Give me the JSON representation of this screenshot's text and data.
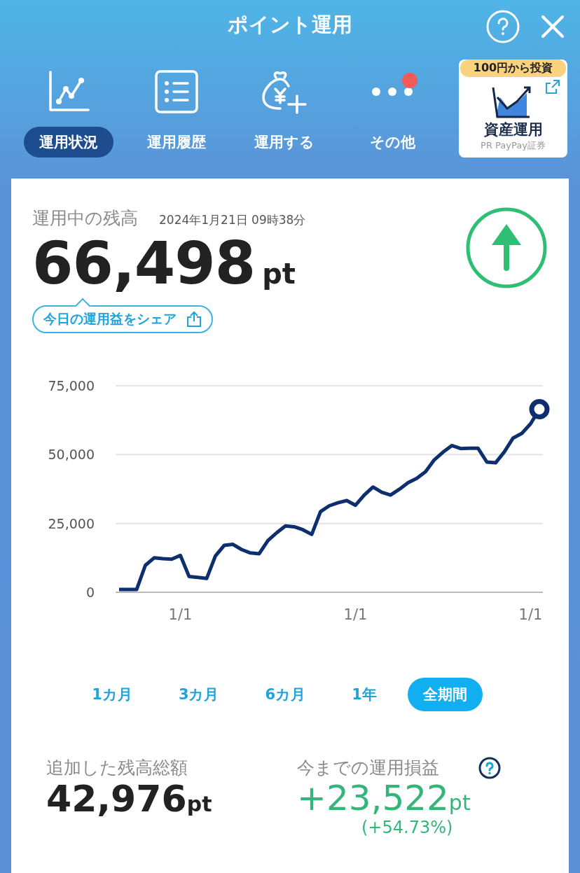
{
  "header": {
    "title": "ポイント運用"
  },
  "nav_tabs": [
    {
      "label": "運用状況",
      "selected": true,
      "kind": "chart",
      "dot": false
    },
    {
      "label": "運用履歴",
      "selected": false,
      "kind": "list",
      "dot": false
    },
    {
      "label": "運用する",
      "selected": false,
      "kind": "bag",
      "dot": false
    },
    {
      "label": "その他",
      "selected": false,
      "kind": "more",
      "dot": true
    }
  ],
  "promo": {
    "badge": "100円から投資",
    "title": "資産運用",
    "caption": "PR PayPay証券"
  },
  "balance": {
    "label": "運用中の残高",
    "timestamp": "2024年1月21日 09時38分",
    "amount": "66,498",
    "unit": "pt",
    "rising": true,
    "share_label": "今日の運用益をシェア"
  },
  "chart": {
    "chart_data": {
      "type": "line",
      "ylim": [
        0,
        75000
      ],
      "yticks": [
        {
          "value": 0,
          "label": "0"
        },
        {
          "value": 25000,
          "label": "25,000"
        },
        {
          "value": 50000,
          "label": "50,000"
        },
        {
          "value": 75000,
          "label": "75,000"
        }
      ],
      "categories": [
        null,
        null,
        null,
        null,
        null,
        null,
        null,
        "1/1",
        null,
        null,
        null,
        null,
        null,
        null,
        null,
        null,
        null,
        null,
        null,
        null,
        null,
        null,
        null,
        null,
        null,
        null,
        null,
        "1/1",
        null,
        null,
        null,
        null,
        null,
        null,
        null,
        null,
        null,
        null,
        null,
        null,
        null,
        null,
        null,
        null,
        null,
        null,
        null,
        "1/1",
        null
      ],
      "series": [
        {
          "color": "#0e2f6e",
          "values": [
            1000,
            1000,
            1000,
            9800,
            12500,
            12200,
            12000,
            13400,
            5700,
            5400,
            5000,
            13200,
            17000,
            17400,
            15500,
            14300,
            14000,
            18800,
            21600,
            24100,
            23800,
            22700,
            21000,
            29300,
            31400,
            32500,
            33300,
            31600,
            35300,
            38200,
            36300,
            35300,
            37400,
            39800,
            41400,
            43800,
            48100,
            50900,
            53300,
            52200,
            52300,
            52300,
            47300,
            47000,
            51000,
            56000,
            57700,
            61200,
            66500
          ]
        }
      ]
    }
  },
  "ranges": [
    {
      "label": "1カ月",
      "selected": false
    },
    {
      "label": "3カ月",
      "selected": false
    },
    {
      "label": "6カ月",
      "selected": false
    },
    {
      "label": "1年",
      "selected": false
    },
    {
      "label": "全期間",
      "selected": true
    }
  ],
  "summary": {
    "deposited": {
      "label": "追加した残高総額",
      "amount": "42,976",
      "unit": "pt"
    },
    "profit": {
      "label": "今までの運用損益",
      "amount": "+23,522",
      "unit": "pt",
      "percent": "(+54.73%)"
    }
  }
}
